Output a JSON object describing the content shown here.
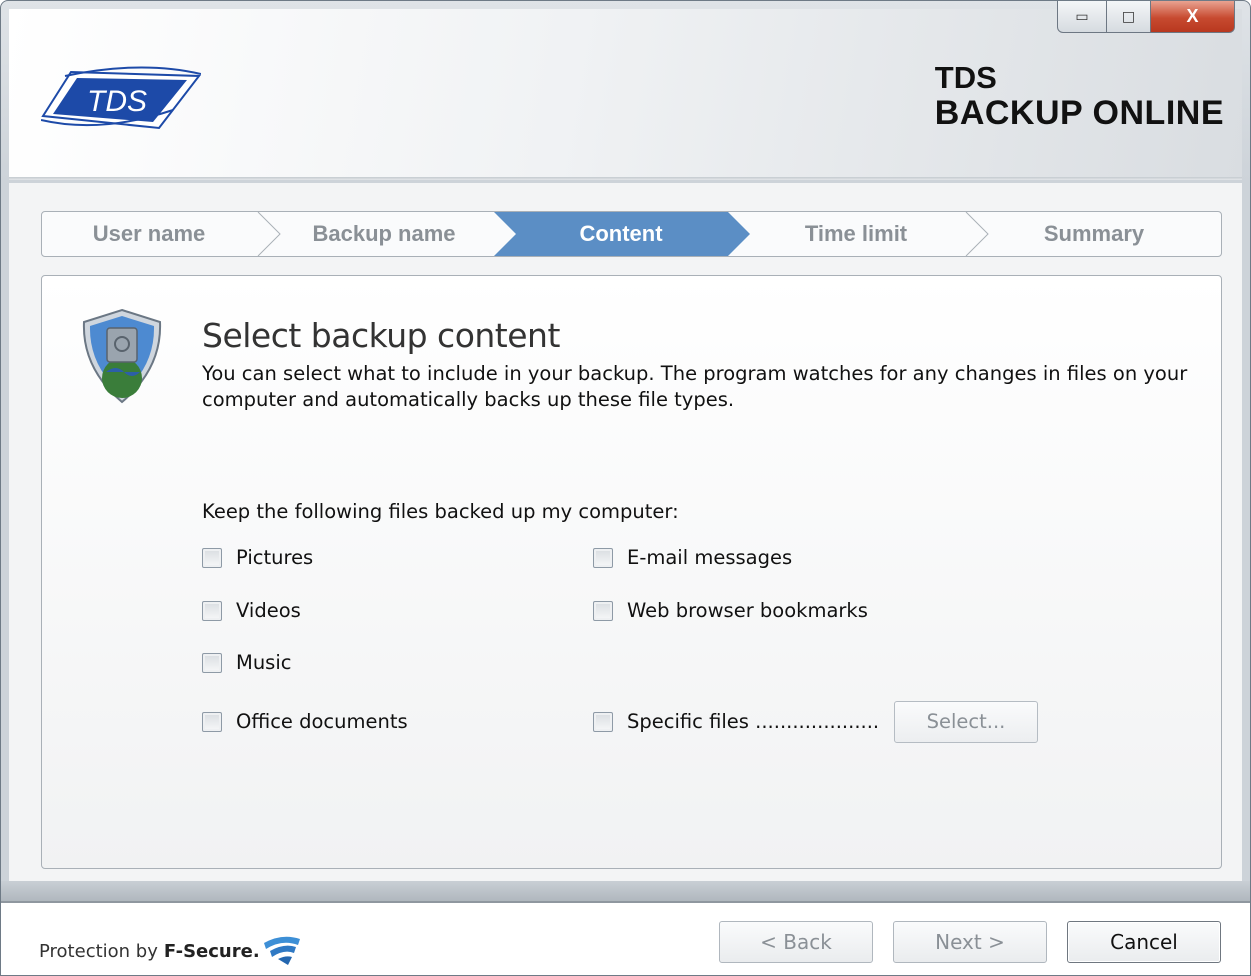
{
  "header": {
    "logo_text": "TDS",
    "brand_line1": "TDS",
    "brand_line2": "BACKUP ONLINE",
    "window_controls": {
      "minimize": "▭",
      "maximize": "□",
      "close": "X"
    }
  },
  "steps": [
    {
      "label": "User name",
      "active": false
    },
    {
      "label": "Backup name",
      "active": false
    },
    {
      "label": "Content",
      "active": true
    },
    {
      "label": "Time limit",
      "active": false
    },
    {
      "label": "Summary",
      "active": false
    }
  ],
  "panel": {
    "title": "Select backup content",
    "description": "You can select what to include in your backup. The program watches for any changes in files on your computer and automatically backs up these file types.",
    "keep_label": "Keep the following files backed up my computer:",
    "options": {
      "pictures": {
        "label": "Pictures",
        "checked": false
      },
      "videos": {
        "label": "Videos",
        "checked": false
      },
      "music": {
        "label": "Music",
        "checked": false
      },
      "office": {
        "label": "Office documents",
        "checked": false
      },
      "email": {
        "label": "E-mail messages",
        "checked": false
      },
      "bookmarks": {
        "label": "Web browser bookmarks",
        "checked": false
      },
      "specific": {
        "label": "Specific files ....................",
        "checked": false
      }
    },
    "select_button": "Select..."
  },
  "footer": {
    "protection_by": "Protection by",
    "vendor": "F-Secure.",
    "back": "< Back",
    "next": "Next >",
    "cancel": "Cancel"
  },
  "colors": {
    "active_step": "#5b8ec5",
    "accent_logo": "#1d4aa8",
    "close_button": "#c74a30"
  }
}
